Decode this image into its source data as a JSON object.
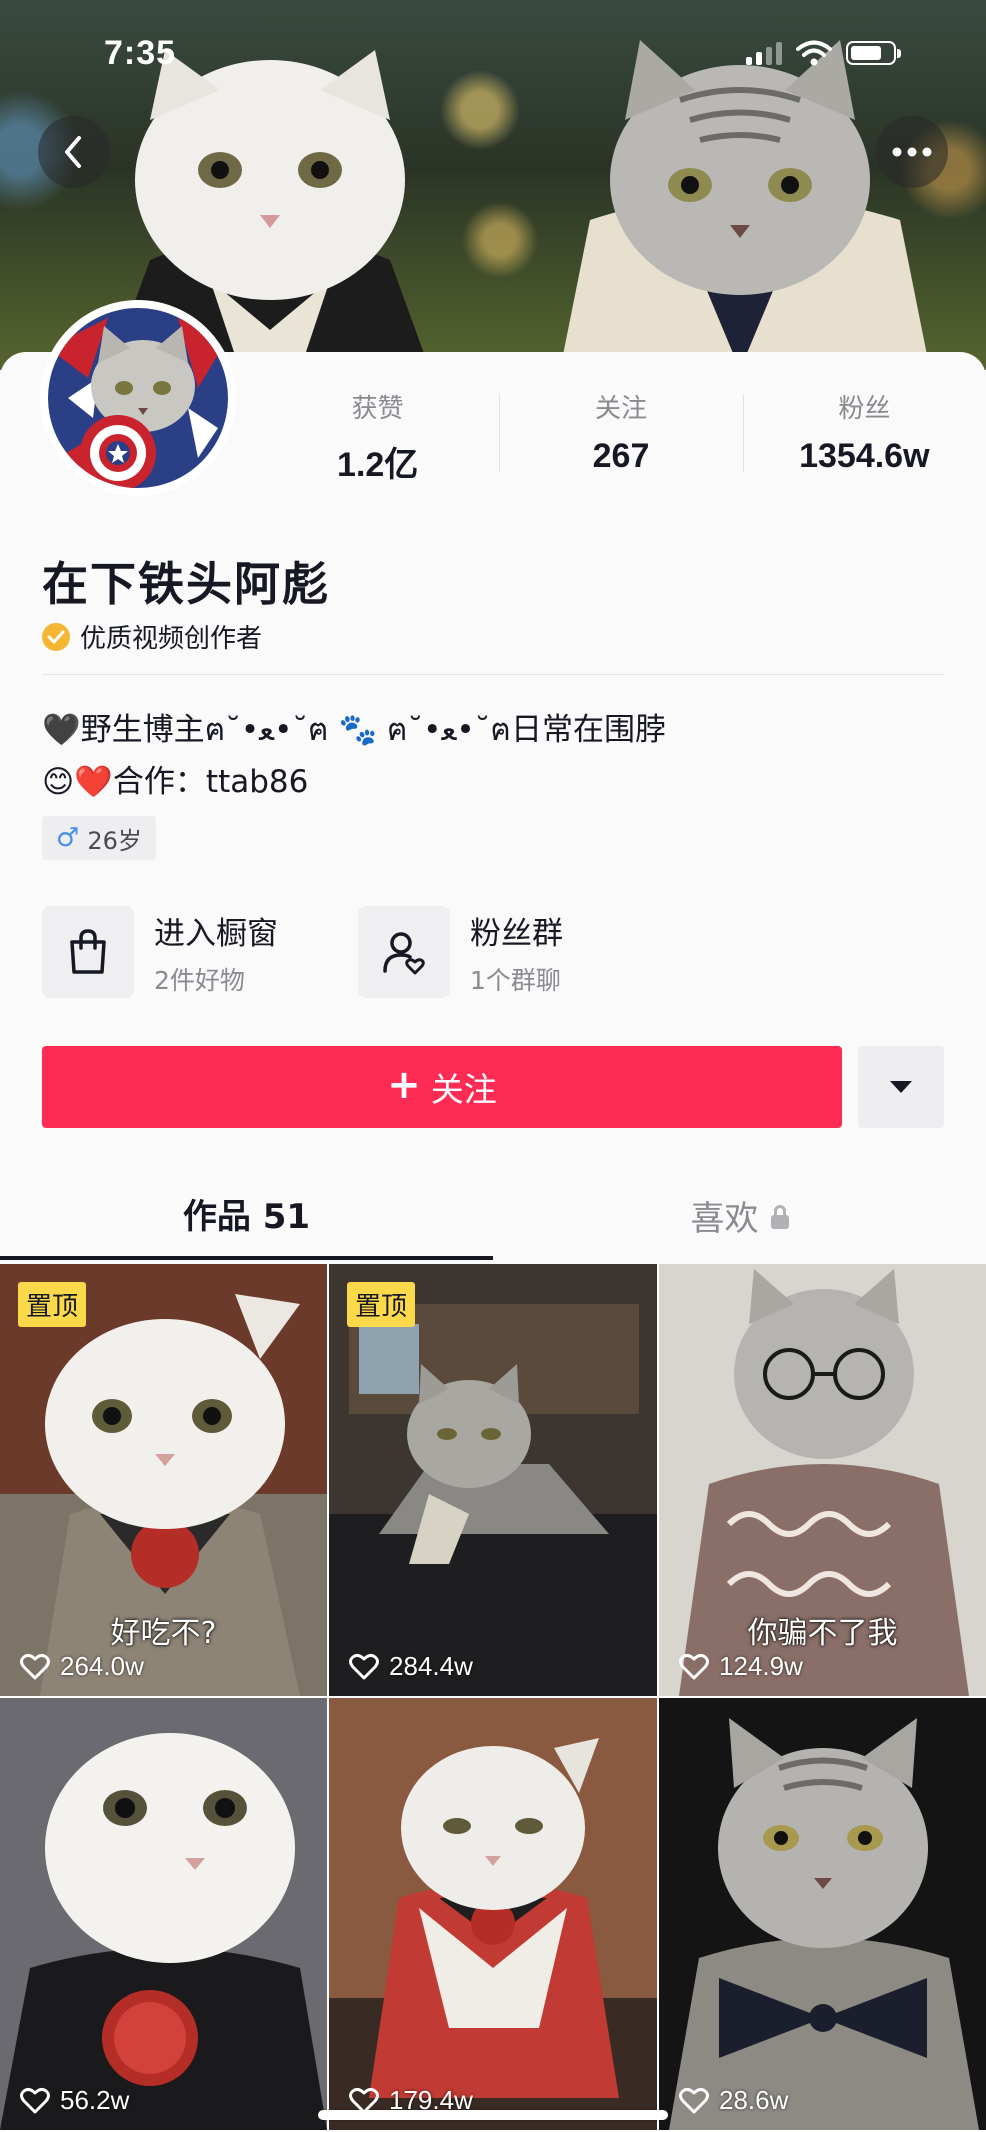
{
  "status_bar": {
    "time": "7:35"
  },
  "profile": {
    "name": "在下铁头阿彪",
    "badge": "优质视频创作者",
    "bio_line1": "🖤野生博主ฅ˘•ﻌ•˘ฅ 🐾 ฅ˘•ﻌ•˘ฅ日常在围脖",
    "bio_line2": "😊❤️合作：ttab86",
    "age": "26岁",
    "stats": [
      {
        "label": "获赞",
        "value": "1.2亿"
      },
      {
        "label": "关注",
        "value": "267"
      },
      {
        "label": "粉丝",
        "value": "1354.6w"
      }
    ]
  },
  "entries": {
    "shop": {
      "title": "进入橱窗",
      "subtitle": "2件好物"
    },
    "fans_group": {
      "title": "粉丝群",
      "subtitle": "1个群聊"
    }
  },
  "actions": {
    "follow_label": "关注",
    "follow_symbol": "+"
  },
  "tabs": {
    "works": "作品 51",
    "likes": "喜欢"
  },
  "videos": [
    {
      "likes": "264.0w",
      "pinned": true,
      "badge": "置顶",
      "caption": "好吃不?"
    },
    {
      "likes": "284.4w",
      "pinned": true,
      "badge": "置顶",
      "caption": ""
    },
    {
      "likes": "124.9w",
      "pinned": false,
      "badge": "",
      "caption": "你骗不了我"
    },
    {
      "likes": "56.2w",
      "pinned": false,
      "badge": "",
      "caption": ""
    },
    {
      "likes": "179.4w",
      "pinned": false,
      "badge": "",
      "caption": ""
    },
    {
      "likes": "28.6w",
      "pinned": false,
      "badge": "",
      "caption": ""
    }
  ],
  "colors": {
    "accent": "#fe2c55",
    "pin_badge": "#fbd94b",
    "verify_badge": "#f5b634"
  }
}
